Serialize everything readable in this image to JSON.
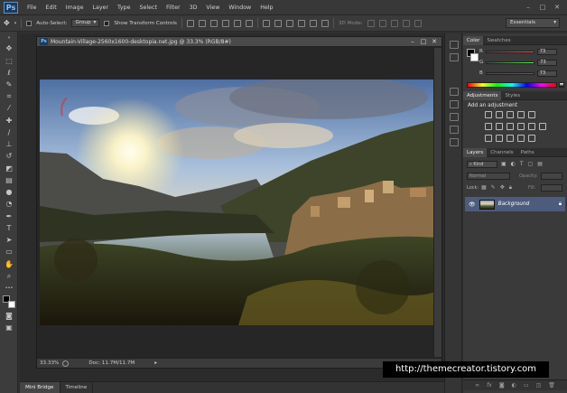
{
  "app": {
    "logo": "Ps"
  },
  "menu": [
    "File",
    "Edit",
    "Image",
    "Layer",
    "Type",
    "Select",
    "Filter",
    "3D",
    "View",
    "Window",
    "Help"
  ],
  "options": {
    "auto_select": "Auto-Select:",
    "auto_select_value": "Group",
    "show_transform": "Show Transform Controls",
    "mode_3d": "3D Mode:",
    "workspace": "Essentials"
  },
  "document": {
    "title": "Mountain-Village-2560x1600-desktopia.net.jpg @ 33.3% (RGB/8#)",
    "zoom": "33.33%",
    "doc_size": "Doc: 11.7M/11.7M"
  },
  "bottom_tabs": [
    "Mini Bridge",
    "Timeline"
  ],
  "color_panel": {
    "tabs": [
      "Color",
      "Swatches"
    ],
    "channels": [
      {
        "label": "R",
        "value": "73",
        "color": "#e33e3e"
      },
      {
        "label": "G",
        "value": "73",
        "color": "#3fbf3f"
      },
      {
        "label": "B",
        "value": "73",
        "color": "#3f6fe3"
      }
    ]
  },
  "adjustments_panel": {
    "tabs": [
      "Adjustments",
      "Styles"
    ],
    "heading": "Add an adjustment"
  },
  "layers_panel": {
    "tabs": [
      "Layers",
      "Channels",
      "Paths"
    ],
    "kind": "Kind",
    "blend_mode": "Normal",
    "opacity_label": "Opacity:",
    "lock_label": "Lock:",
    "fill_label": "Fill:",
    "layer_name": "Background"
  },
  "watermark": "http://themecreator.tistory.com"
}
